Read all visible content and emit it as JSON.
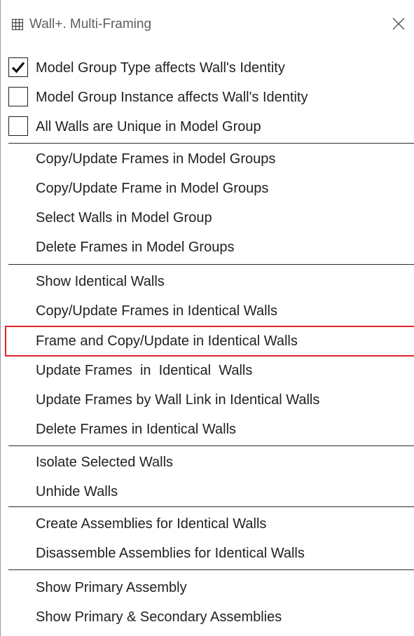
{
  "window": {
    "title": "Wall+. Multi-Framing"
  },
  "checkboxes": [
    {
      "label": "Model Group Type affects Wall's Identity",
      "checked": true
    },
    {
      "label": "Model Group Instance affects Wall's Identity",
      "checked": false
    },
    {
      "label": "All Walls are Unique in Model Group",
      "checked": false
    }
  ],
  "group_model": [
    "Copy/Update Frames in Model Groups",
    "Copy/Update Frame in Model Groups",
    "Select Walls in Model Group",
    "Delete Frames in Model Groups"
  ],
  "group_identical": [
    "Show Identical Walls",
    "Copy/Update Frames in Identical Walls",
    "Frame and Copy/Update in Identical Walls",
    "Update Frames  in  Identical  Walls",
    "Update Frames by Wall Link in Identical Walls",
    "Delete Frames in Identical Walls"
  ],
  "group_visibility": [
    "Isolate Selected Walls",
    "Unhide Walls"
  ],
  "group_assemblies": [
    "Create Assemblies for Identical Walls",
    "Disassemble Assemblies for Identical Walls"
  ],
  "group_primary": [
    "Show Primary Assembly",
    "Show Primary & Secondary Assemblies"
  ],
  "highlighted_item": "Frame and Copy/Update in Identical Walls",
  "colors": {
    "highlight_border": "#e0262d",
    "separator": "#2a2a2a",
    "text": "#222222"
  },
  "icons": {
    "app": "grid-icon",
    "close": "close-icon",
    "check": "checkmark-icon"
  }
}
